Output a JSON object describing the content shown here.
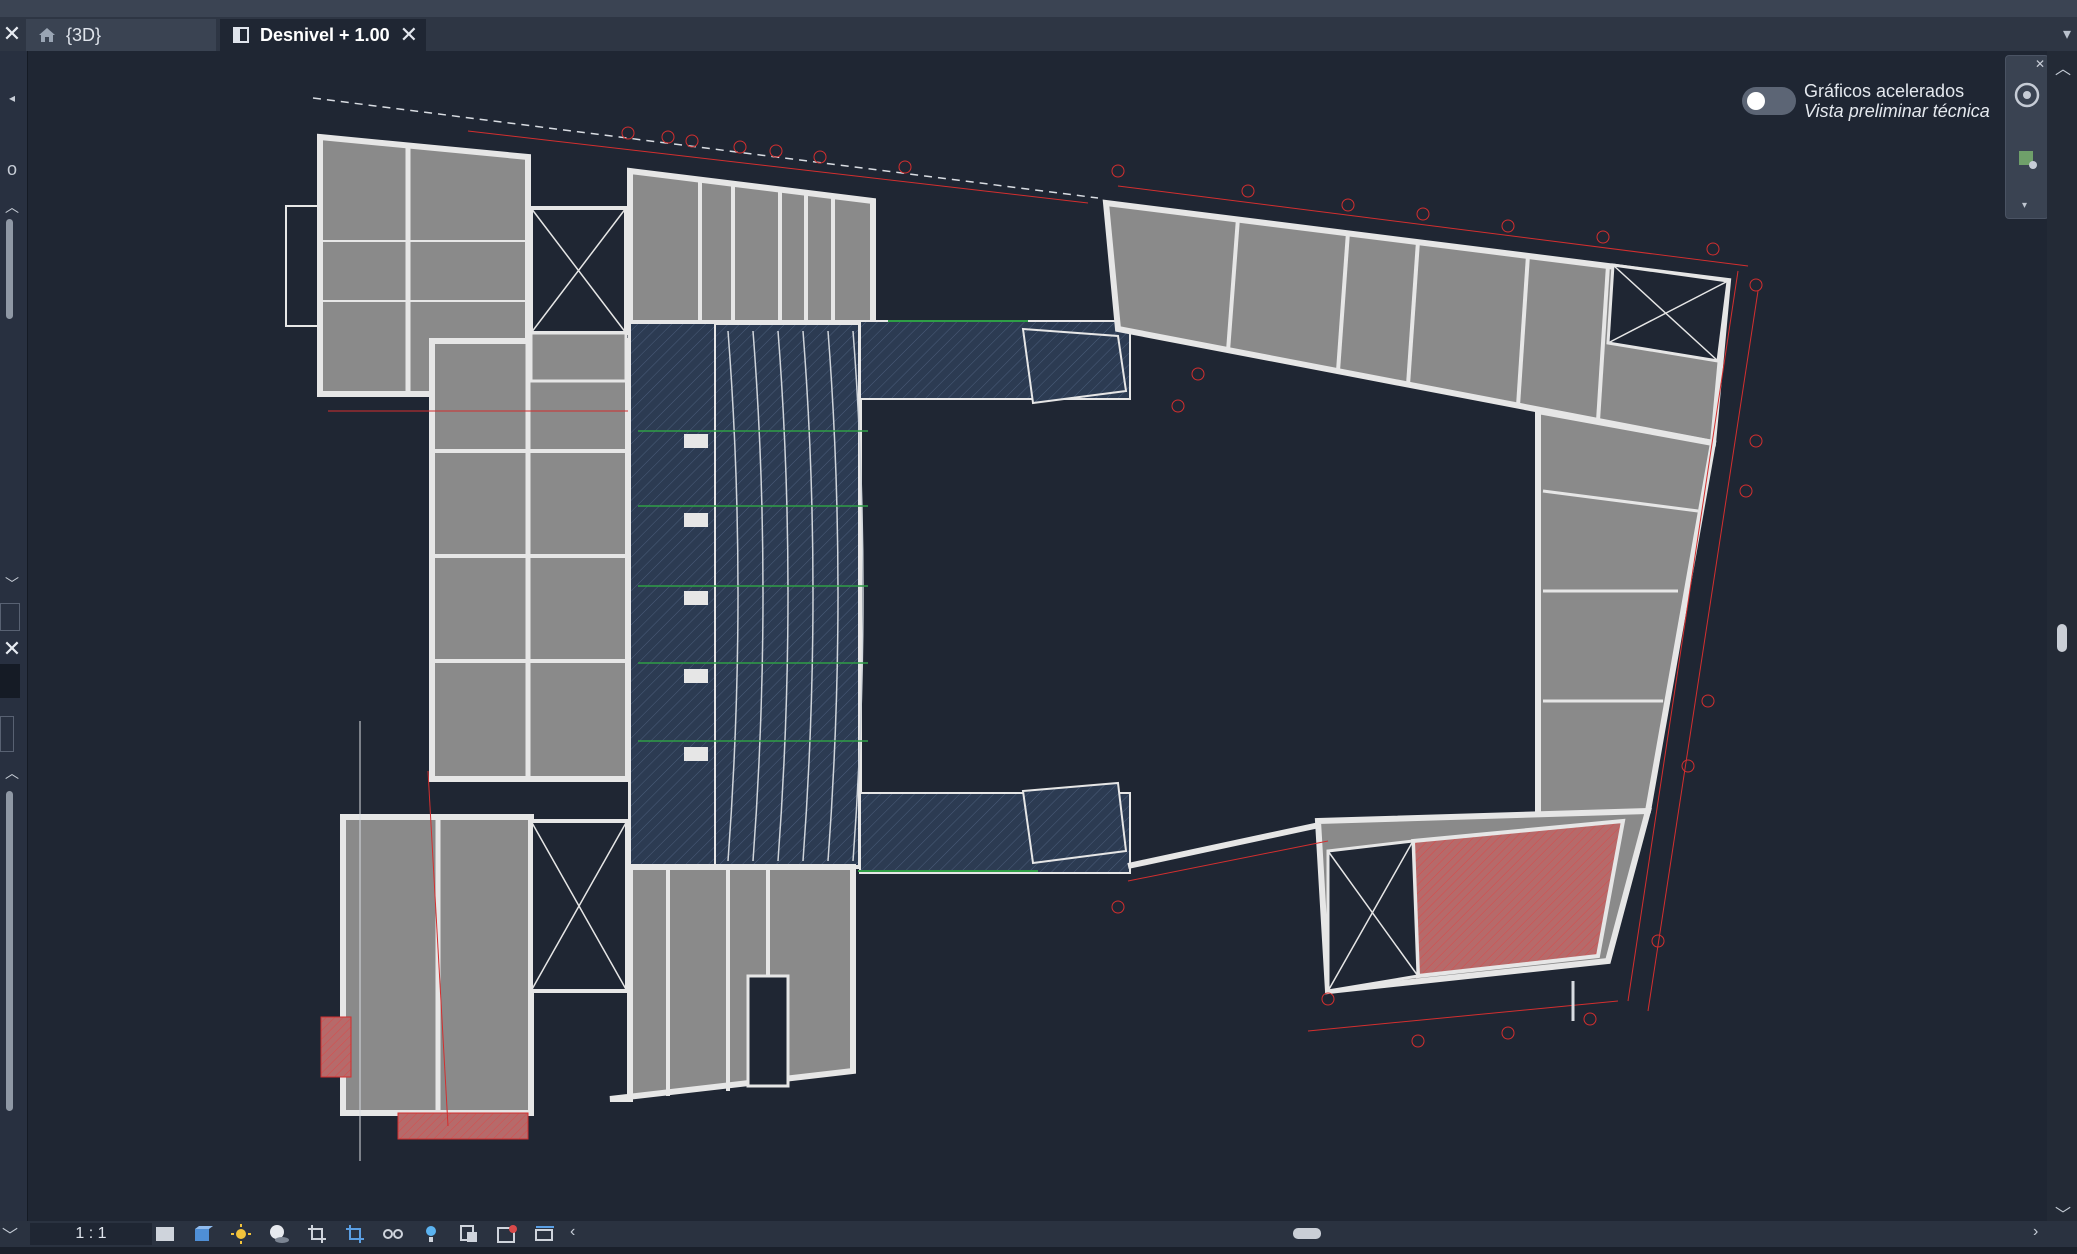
{
  "tabs": [
    {
      "label": "{3D}",
      "icon": "home-icon",
      "active": false
    },
    {
      "label": "Desnivel + 1.00",
      "icon": "floor-plan-view-icon",
      "active": true
    }
  ],
  "graphics": {
    "title": "Gráficos acelerados",
    "subtitle": "Vista preliminar técnica",
    "enabled": false
  },
  "left_dock": {
    "partial_label": "o"
  },
  "status_bar": {
    "scale": "1 : 1",
    "icons": [
      "detail-level-icon",
      "visual-style-icon",
      "sun-path-icon",
      "shadows-icon",
      "crop-view-icon",
      "show-crop-region-icon",
      "temporary-hide-icon",
      "reveal-hidden-icon",
      "worksharing-icon",
      "analytical-model-icon",
      "highlight-displacement-icon"
    ]
  },
  "colors": {
    "canvas": "#1f2633",
    "wall": "#e6e6e6",
    "slab": "#8a8a8a",
    "grid_line": "#d32f2f",
    "hatch": "#2c3b52",
    "accent_green": "#2e9e46"
  }
}
